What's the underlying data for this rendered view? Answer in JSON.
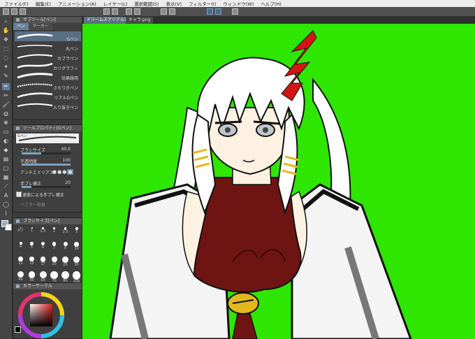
{
  "menu": [
    "ファイル(F)",
    "編集(E)",
    "アニメーション(A)",
    "レイヤー(L)",
    "選択範囲(S)",
    "表示(V)",
    "フィルター(I)",
    "ウィンドウ(W)",
    "ヘルプ(H)"
  ],
  "subtool_panel": {
    "title": "サブツール[ペン]",
    "tabs": [
      "ペン",
      "マーカー"
    ],
    "brushes": [
      "Gペン",
      "丸ペン",
      "カブラペン",
      "カリグラフィ",
      "効果線用",
      "さらつきペン",
      "リアルGペン",
      "入り抜きペン"
    ]
  },
  "tool_property": {
    "title": "ツールプロパティ[Gペン]",
    "preset": "Gペン",
    "rows": [
      {
        "label": "ブラシサイズ",
        "value": "40.0"
      },
      {
        "label": "不透明度",
        "value": "100"
      },
      {
        "label": "アンチエイリアス",
        "value": ""
      },
      {
        "label": "手ブレ補正",
        "value": "20"
      },
      {
        "label": "速度による手ブレ補正",
        "value": ""
      },
      {
        "label": "ベクター吸着",
        "value": ""
      }
    ],
    "opacity_fraction": 1.0,
    "size_fraction": 0.4,
    "stabilizer_fraction": 0.2
  },
  "brush_size_panel": {
    "title": "ブラシサイズ[ペン]",
    "sizes": [
      "0.7",
      "1",
      "1.5",
      "2",
      "2.5",
      "3",
      "4",
      "5",
      "6",
      "7",
      "8",
      "10",
      "12",
      "15",
      "17",
      "20",
      "25",
      "30",
      "40",
      "50",
      "60",
      "70",
      "80",
      "100"
    ]
  },
  "color_panel": {
    "title": "カラーサークル",
    "main_color": "#e11d1d",
    "sub_color": "#ffffff"
  },
  "documents": {
    "tabs": [
      "ドリームスアリアル立ち絵",
      "キャラ.png"
    ]
  },
  "canvas": {
    "background": "#2ee600"
  }
}
